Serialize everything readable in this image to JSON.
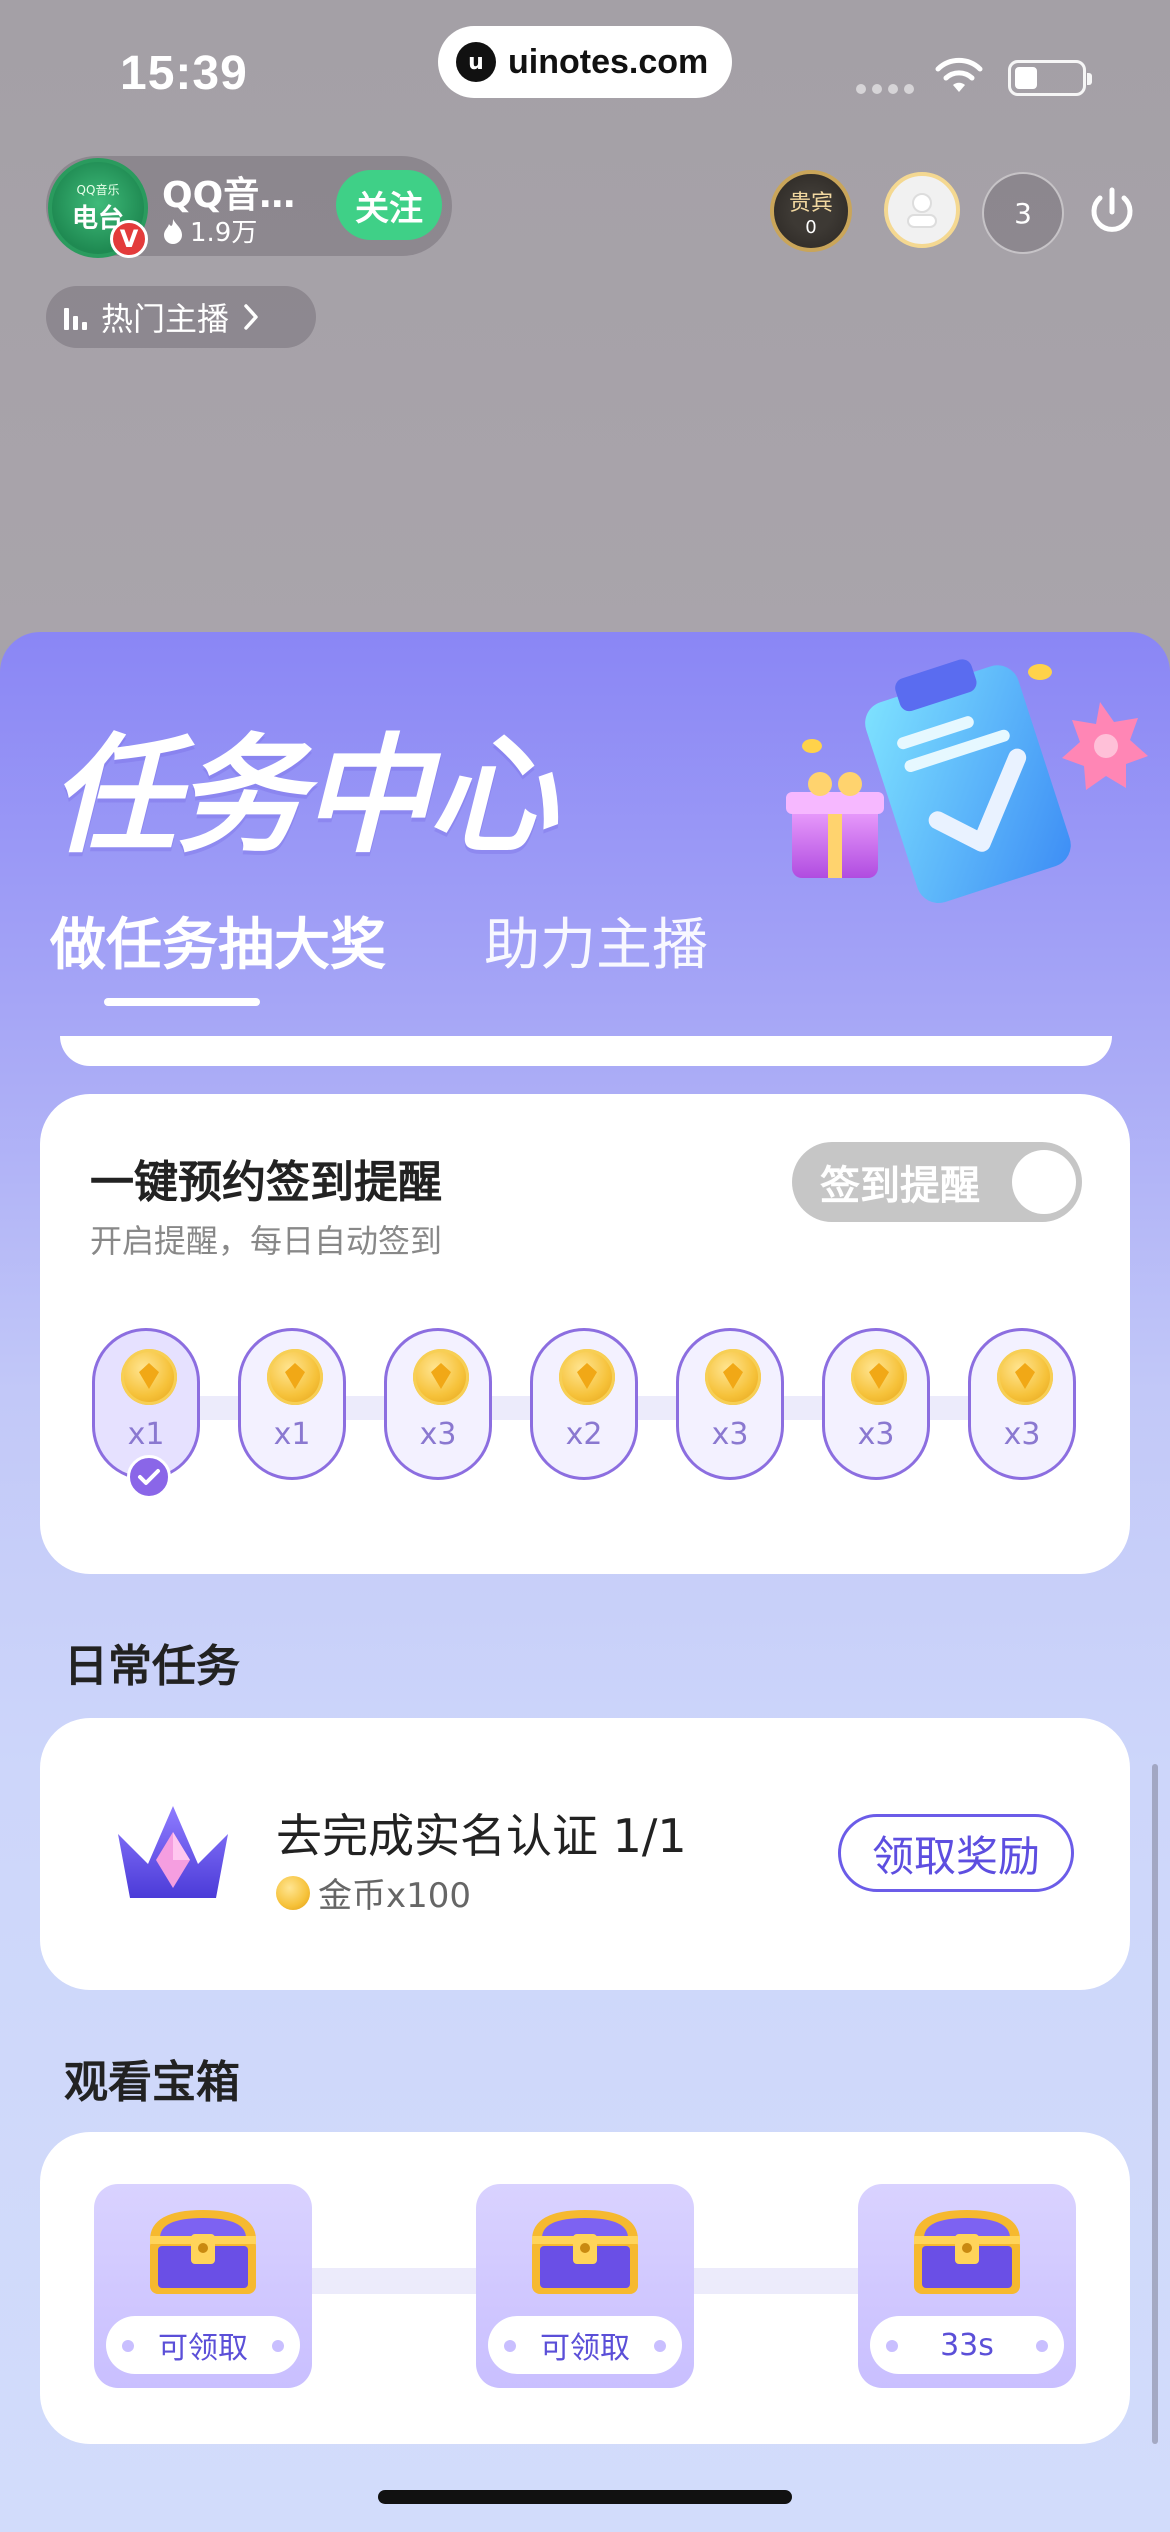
{
  "status_bar": {
    "time": "15:39",
    "watermark": "uinotes.com"
  },
  "anchor": {
    "name": "QQ音…",
    "hot": "1.9万",
    "follow_label": "关注",
    "avatar_small": "QQ音乐",
    "avatar_big": "电台",
    "verified": "V"
  },
  "hot_anchor_label": "热门主播",
  "vip": {
    "label": "贵宾",
    "count": "0"
  },
  "viewer_count": "3",
  "panel": {
    "title": "任务中心",
    "tabs": [
      {
        "label": "做任务抽大奖",
        "active": true
      },
      {
        "label": "助力主播",
        "active": false
      }
    ]
  },
  "checkin": {
    "title": "一键预约签到提醒",
    "subtitle": "开启提醒，每日自动签到",
    "toggle_label": "签到提醒",
    "toggle_on": false,
    "days": [
      {
        "mult": "x1",
        "done": true
      },
      {
        "mult": "x1",
        "done": false
      },
      {
        "mult": "x3",
        "done": false
      },
      {
        "mult": "x2",
        "done": false
      },
      {
        "mult": "x3",
        "done": false
      },
      {
        "mult": "x3",
        "done": false
      },
      {
        "mult": "x3",
        "done": false
      }
    ]
  },
  "daily": {
    "section_title": "日常任务",
    "task_name": "去完成实名认证 1/1",
    "reward": "金币x100",
    "claim_label": "领取奖励"
  },
  "boxes": {
    "section_title": "观看宝箱",
    "items": [
      {
        "label": "可领取"
      },
      {
        "label": "可领取"
      },
      {
        "label": "33s"
      }
    ]
  },
  "colors": {
    "accent": "#6b5ce8",
    "follow": "#3fd087",
    "panel_top": "#8a86f5"
  }
}
